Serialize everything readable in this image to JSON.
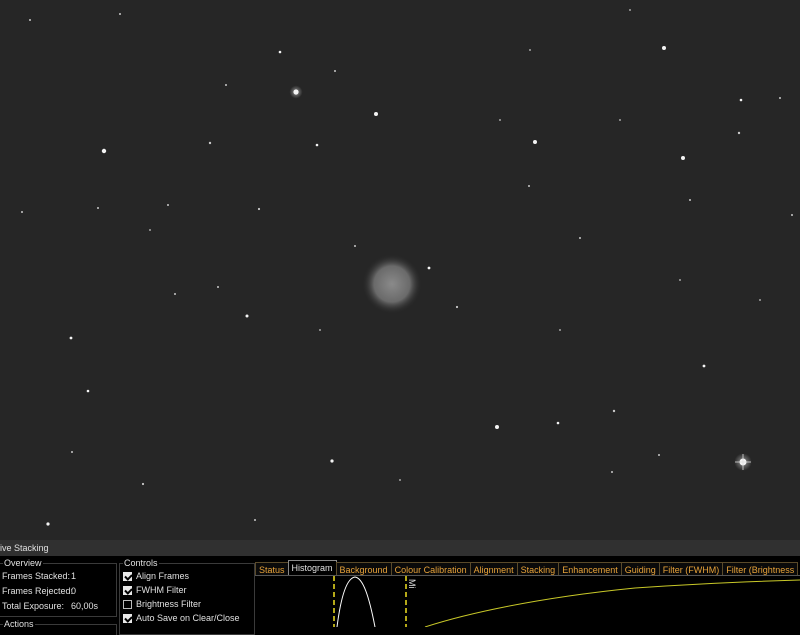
{
  "window": {
    "title": "ive Stacking"
  },
  "overview": {
    "title": "Overview",
    "frames_stacked_label": "Frames Stacked:",
    "frames_stacked_value": "1",
    "frames_rejected_label": "Frames Rejected:",
    "frames_rejected_value": "0",
    "total_exposure_label": "Total Exposure:",
    "total_exposure_value": "60,00s"
  },
  "actions": {
    "title": "Actions"
  },
  "controls": {
    "title": "Controls",
    "items": [
      {
        "label": "Align Frames",
        "checked": true
      },
      {
        "label": "FWHM Filter",
        "checked": true
      },
      {
        "label": "Brightness Filter",
        "checked": false
      },
      {
        "label": "Auto Save on Clear/Close",
        "checked": true
      }
    ]
  },
  "tabs": [
    {
      "label": "Status",
      "active": false
    },
    {
      "label": "Histogram",
      "active": true
    },
    {
      "label": "Background",
      "active": false
    },
    {
      "label": "Colour Calibration",
      "active": false
    },
    {
      "label": "Alignment",
      "active": false
    },
    {
      "label": "Stacking",
      "active": false
    },
    {
      "label": "Enhancement",
      "active": false
    },
    {
      "label": "Guiding",
      "active": false
    },
    {
      "label": "Filter (FWHM)",
      "active": false
    },
    {
      "label": "Filter (Brightness",
      "active": false
    }
  ],
  "histogram": {
    "marker_label": "Mi",
    "curve_color": "#ffffff",
    "marker_color": "#f0e020",
    "stretch_color": "#c8c828"
  },
  "colors": {
    "sky": "#262626",
    "accent_tab": "#e8a33a",
    "panel_bg": "#000000"
  }
}
